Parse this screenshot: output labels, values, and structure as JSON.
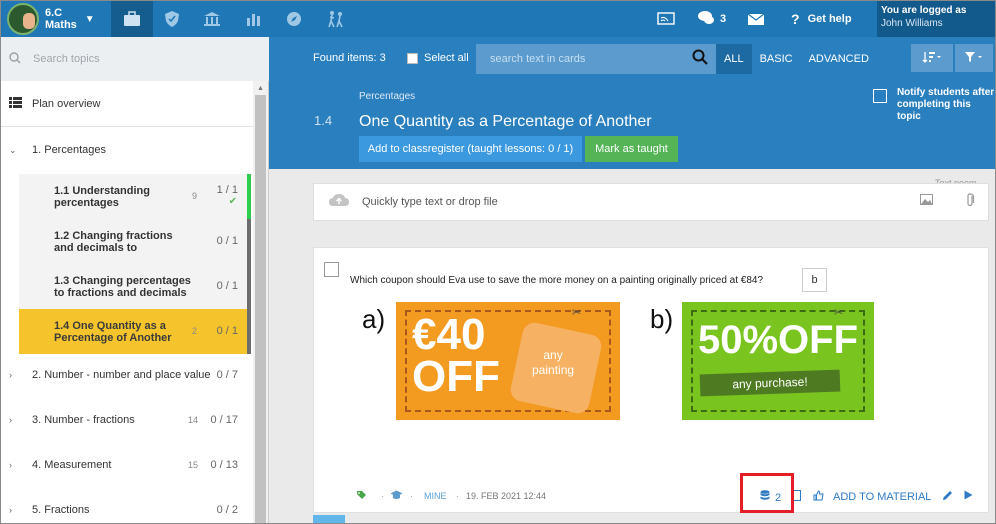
{
  "topbar": {
    "class_name_line1": "6.C",
    "class_name_line2": "Maths",
    "messages_count": "3",
    "get_help": "Get help",
    "logged_label": "You are logged as",
    "user_name": "John Williams"
  },
  "sidebar": {
    "search_placeholder": "Search topics",
    "plan_overview": "Plan overview",
    "topics": [
      {
        "name": "1. Percentages",
        "count": "",
        "progress": ""
      },
      {
        "name": "2. Number - number and place value",
        "count": "",
        "progress": "0 / 7"
      },
      {
        "name": "3. Number - fractions",
        "count": "14",
        "progress": "0 / 17"
      },
      {
        "name": "4. Measurement",
        "count": "15",
        "progress": "0 / 13"
      },
      {
        "name": "5. Fractions",
        "count": "",
        "progress": "0 / 2"
      }
    ],
    "subtopics": [
      {
        "line1": "1.1  Understanding",
        "line2": "percentages",
        "count": "9",
        "progress": "1 / 1"
      },
      {
        "line1": "1.2  Changing fractions",
        "line2": "and decimals to",
        "count": "",
        "progress": "0 / 1"
      },
      {
        "line1": "1.3  Changing percentages",
        "line2": "to fractions and decimals",
        "count": "",
        "progress": "0 / 1"
      },
      {
        "line1": "1.4  One Quantity as a",
        "line2": "Percentage of Another",
        "count": "2",
        "progress": "0 / 1"
      }
    ]
  },
  "main": {
    "found_items": "Found items: 3",
    "select_all": "Select all",
    "search_placeholder": "search text in cards",
    "tabs": [
      "ALL",
      "BASIC",
      "ADVANCED"
    ],
    "breadcrumb": "Percentages",
    "lesson_number": "1.4",
    "lesson_title": "One Quantity as a Percentage of Another",
    "register_button": "Add to classregister (taught lessons: 0 / 1)",
    "mark_taught_button": "Mark as taught",
    "notify_line1": "Notify students after",
    "notify_line2": "completing this topic",
    "quick_placeholder": "Quickly type text or drop file",
    "text_pane_label": "Text poem"
  },
  "card": {
    "question": "Which coupon should Eva use to save the more money on a painting originally priced at €84?",
    "answer": "b",
    "label_a": "a)",
    "label_b": "b)",
    "coupon_a_big_line1": "€40",
    "coupon_a_big_line2": "OFF",
    "coupon_a_small_line1": "any",
    "coupon_a_small_line2": "painting",
    "coupon_b_big": "50%OFF",
    "coupon_b_small": "any purchase!",
    "owner": "MINE",
    "date": "19. FEB 2021 12:44",
    "db_count": "2",
    "add_to_material": "ADD TO MATERIAL"
  },
  "colors": {
    "primary": "#2a7fbf",
    "topbar": "#1f77b5",
    "selected_topic": "#f5c42c",
    "taught_green": "#54b456",
    "coupon_orange": "#f39a21",
    "coupon_green": "#7ac41f",
    "highlight": "#e41e26"
  }
}
